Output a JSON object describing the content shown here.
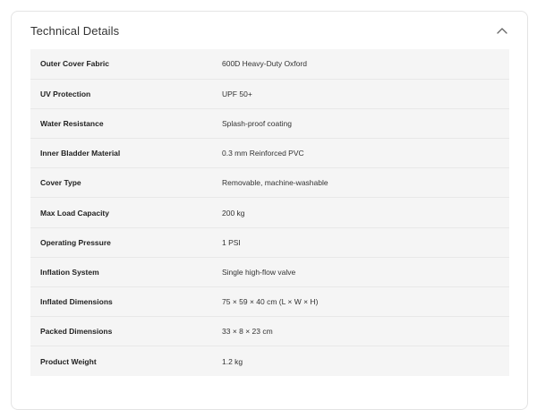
{
  "section": {
    "title": "Technical Details",
    "toggle_icon": "chevron-up-icon",
    "expanded": true
  },
  "specs": [
    {
      "label": "Outer Cover Fabric",
      "value": "600D Heavy-Duty Oxford"
    },
    {
      "label": "UV Protection",
      "value": "UPF 50+"
    },
    {
      "label": "Water Resistance",
      "value": "Splash-proof coating"
    },
    {
      "label": "Inner Bladder Material",
      "value": "0.3 mm Reinforced PVC"
    },
    {
      "label": "Cover Type",
      "value": "Removable, machine-washable"
    },
    {
      "label": "Max Load Capacity",
      "value": "200 kg"
    },
    {
      "label": "Operating Pressure",
      "value": "1 PSI"
    },
    {
      "label": "Inflation System",
      "value": "Single high-flow valve"
    },
    {
      "label": "Inflated Dimensions",
      "value": "75 × 59 × 40 cm (L × W × H)"
    },
    {
      "label": "Packed Dimensions",
      "value": "33 × 8 × 23 cm"
    },
    {
      "label": "Product Weight",
      "value": "1.2 kg"
    }
  ]
}
